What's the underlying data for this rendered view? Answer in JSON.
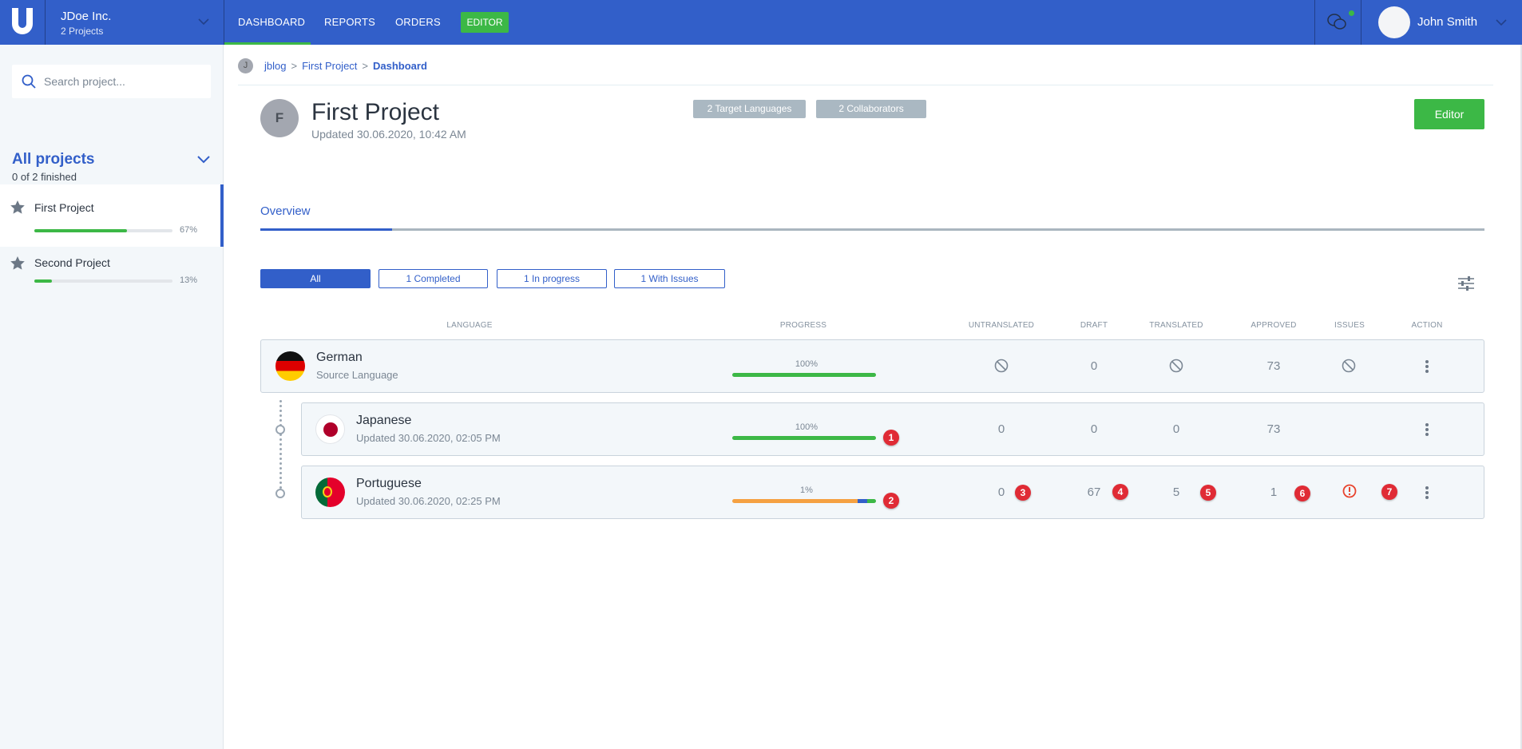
{
  "topbar": {
    "company": "JDoe Inc.",
    "projects_count": "2 Projects",
    "nav": [
      "DASHBOARD",
      "REPORTS",
      "ORDERS"
    ],
    "editor_label": "EDITOR",
    "user_name": "John Smith",
    "accent": "#325fc9",
    "green": "#3cb846"
  },
  "sidebar": {
    "search_placeholder": "Search project...",
    "section_title": "All projects",
    "section_sub": "0 of 2 finished",
    "projects": [
      {
        "name": "First Project",
        "percent": "67%",
        "progress": 67
      },
      {
        "name": "Second Project",
        "percent": "13%",
        "progress": 13
      }
    ]
  },
  "breadcrumb": {
    "avatar": "J",
    "items": [
      "jblog",
      "First Project",
      "Dashboard"
    ],
    "sep": ">"
  },
  "project": {
    "avatar": "F",
    "title": "First Project",
    "updated": "Updated 30.06.2020, 10:42 AM",
    "badge_languages": "2 Target Languages",
    "badge_collaborators": "2 Collaborators",
    "editor_button": "Editor"
  },
  "tabs": {
    "overview": "Overview"
  },
  "filters": [
    "All",
    "1 Completed",
    "1 In progress",
    "1 With Issues"
  ],
  "columns": [
    "LANGUAGE",
    "PROGRESS",
    "UNTRANSLATED",
    "DRAFT",
    "TRANSLATED",
    "APPROVED",
    "ISSUES",
    "ACTION"
  ],
  "rows": [
    {
      "name": "German",
      "sub": "Source Language",
      "percent": "100%",
      "untranslated": "",
      "draft": "0",
      "translated": "",
      "approved": "73"
    },
    {
      "name": "Japanese",
      "sub": "Updated 30.06.2020, 02:05 PM",
      "percent": "100%",
      "untranslated": "0",
      "draft": "0",
      "translated": "0",
      "approved": "73"
    },
    {
      "name": "Portuguese",
      "sub": "Updated 30.06.2020, 02:25 PM",
      "percent": "1%",
      "untranslated": "0",
      "draft": "67",
      "translated": "5",
      "approved": "1"
    }
  ],
  "markers": [
    "1",
    "2",
    "3",
    "4",
    "5",
    "6",
    "7"
  ]
}
